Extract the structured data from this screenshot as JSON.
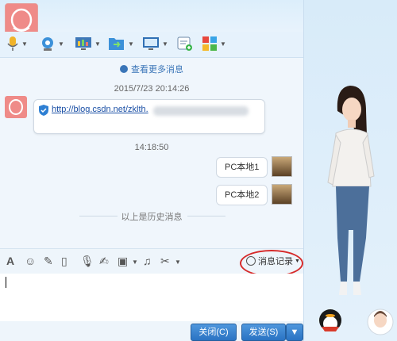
{
  "chat": {
    "more_messages": "查看更多消息",
    "date_time": "2015/7/23 20:14:26",
    "link_url": "http://blog.csdn.net/zklth.",
    "time2": "14:18:50",
    "messages": [
      "PC本地1",
      "PC本地2"
    ],
    "history_marker": "以上是历史消息"
  },
  "input_toolbar": {
    "history_button": "消息记录"
  },
  "buttons": {
    "close": "关闭(C)",
    "send": "发送(S)"
  },
  "colors": {
    "accent": "#2a73c3",
    "highlight_circle": "#d62a2a",
    "link": "#1a4fa5"
  },
  "icons": [
    "microphone-icon",
    "camera-icon",
    "screen-share-icon",
    "file-transfer-icon",
    "remote-desktop-icon",
    "app-add-icon",
    "apps-icon"
  ]
}
